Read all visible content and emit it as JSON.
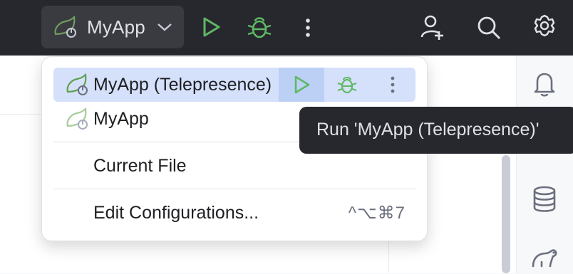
{
  "toolbar": {
    "config_name": "MyApp",
    "icons": [
      "app-config-icon",
      "chevron-down-icon",
      "run-icon",
      "debug-icon",
      "more-vertical-icon",
      "add-user-icon",
      "search-icon",
      "gear-icon"
    ]
  },
  "colors": {
    "run_green": "#5fb865",
    "selected_row": "#d5e1fb",
    "hover_button": "#bcd0f6",
    "titlebar": "#27282e",
    "tooltip_bg": "#27282e"
  },
  "popup": {
    "items": [
      {
        "label": "MyApp (Telepresence)",
        "selected": true
      },
      {
        "label": "MyApp",
        "selected": false
      }
    ],
    "current_file": "Current File",
    "edit_configurations": "Edit Configurations...",
    "edit_shortcut": "^⌥⌘7"
  },
  "tooltip": {
    "text": "Run 'MyApp (Telepresence)'"
  },
  "right_toolbar": {
    "icons": [
      "notifications-icon",
      "database-icon",
      "gradle-icon"
    ]
  }
}
